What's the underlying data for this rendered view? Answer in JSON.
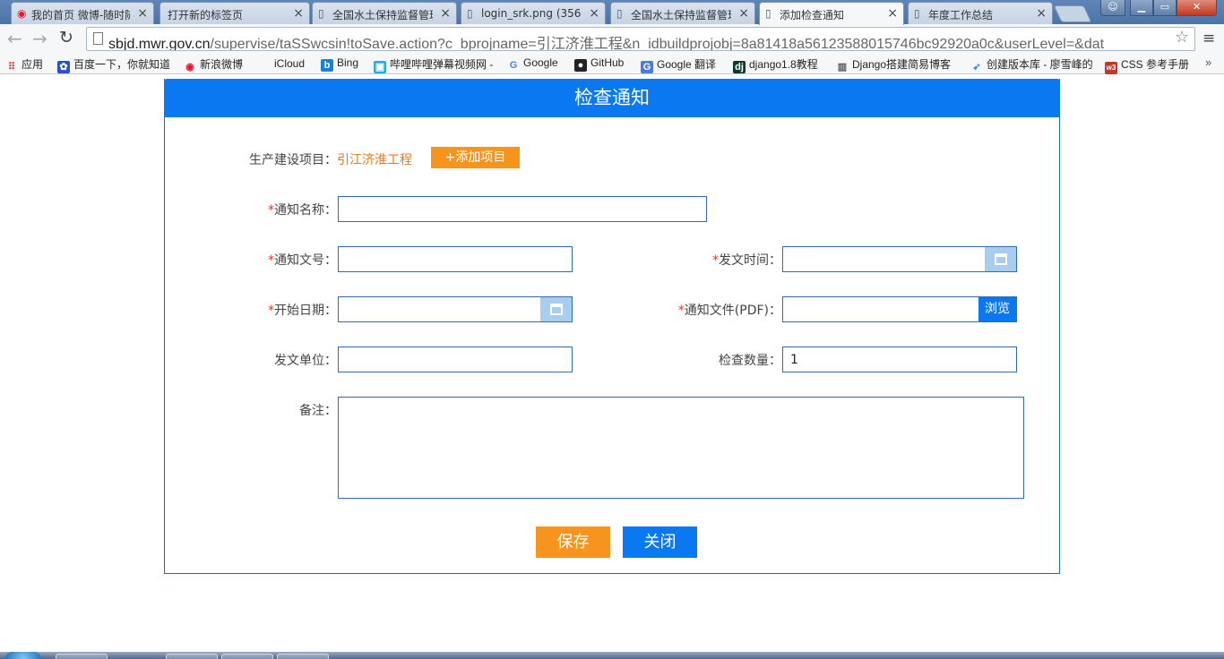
{
  "browser": {
    "tabs": [
      {
        "title": "我的首页 微博-随时随",
        "icon": "weibo-icon"
      },
      {
        "title": "打开新的标签页",
        "icon": ""
      },
      {
        "title": "全国水土保持监督管理",
        "icon": "page-icon"
      },
      {
        "title": "login_srk.png (356×",
        "icon": "page-icon"
      },
      {
        "title": "全国水土保持监督管理",
        "icon": "page-icon"
      },
      {
        "title": "添加检查通知",
        "icon": "page-icon"
      },
      {
        "title": "年度工作总结",
        "icon": "page-icon"
      }
    ],
    "url_host": "sbjd.mwr.gov.cn",
    "url_rest": "/supervise/taSSwcsin!toSave.action?c_bprojname=引江济淮工程&n_idbuildprojobj=8a81418a56123588015746bc92920a0c&userLevel=&dat",
    "bookmarks": [
      {
        "label": "应用",
        "icon": "apps-grid-icon",
        "color": "#d33"
      },
      {
        "label": "百度一下，你就知道",
        "icon": "baidu-paw-icon",
        "color": "#2a4fd1"
      },
      {
        "label": "新浪微博",
        "icon": "weibo-icon",
        "color": "#e6162d"
      },
      {
        "label": "iCloud",
        "icon": "apple-icon",
        "color": "#444"
      },
      {
        "label": "Bing",
        "icon": "bing-icon",
        "color": "#1a7fd6"
      },
      {
        "label": "哔哩哔哩弹幕视频网 -",
        "icon": "bilibili-icon",
        "color": "#23ade5"
      },
      {
        "label": "Google",
        "icon": "google-icon",
        "color": "#4285f4"
      },
      {
        "label": "GitHub",
        "icon": "github-icon",
        "color": "#222"
      },
      {
        "label": "Google 翻译",
        "icon": "google-translate-icon",
        "color": "#4a7be0"
      },
      {
        "label": "django1.8教程",
        "icon": "django-icon",
        "color": "#0c3c26"
      },
      {
        "label": "Django搭建简易博客",
        "icon": "book-icon",
        "color": "#555"
      },
      {
        "label": "创建版本库 - 廖雪峰的",
        "icon": "rocket-icon",
        "color": "#3b8be0"
      },
      {
        "label": "CSS 参考手册",
        "icon": "w3school-icon",
        "color": "#c0392b"
      }
    ]
  },
  "form": {
    "title": "检查通知",
    "project_label": "生产建设项目：",
    "project_name": "引江济淮工程",
    "add_project_button": "+添加项目",
    "notice_name_label": "通知名称：",
    "notice_number_label": "通知文号：",
    "issue_time_label": "发文时间：",
    "start_date_label": "开始日期：",
    "notice_file_label": "通知文件(PDF)：",
    "browse_button": "浏览",
    "issuing_unit_label": "发文单位：",
    "check_count_label": "检查数量：",
    "check_count_value": "1",
    "remarks_label": "备注：",
    "required_mark": "*",
    "save_button": "保存",
    "close_button": "关闭"
  },
  "colors": {
    "primary": "#0a78f0",
    "accent": "#f7941d",
    "required": "#e0362c",
    "project_name": "#e07a1f"
  }
}
